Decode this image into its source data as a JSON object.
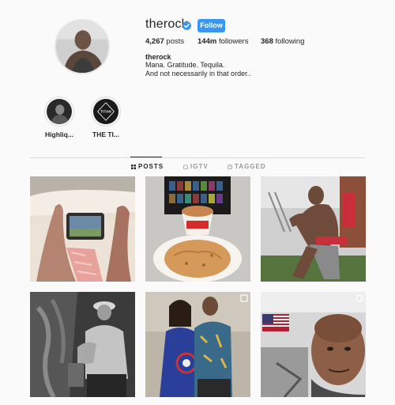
{
  "profile": {
    "username": "therock",
    "verified": true,
    "follow_label": "Follow",
    "posts_count": "4,267",
    "posts_label": "posts",
    "followers_count": "144m",
    "followers_label": "followers",
    "following_count": "368",
    "following_label": "following",
    "full_name": "therock",
    "bio_line1": "Mana. Gratitude. Tequila.",
    "bio_line2": "And not necessarily in that order.."
  },
  "highlights": [
    {
      "label": "Highliq...",
      "icon": "highlight-cover-photo"
    },
    {
      "label": "THE TI...",
      "icon": "titan-logo-icon",
      "logo_text": "TITAN"
    }
  ],
  "tabs": [
    {
      "label": "POSTS",
      "icon": "grid-icon",
      "active": true
    },
    {
      "label": "IGTV",
      "icon": "igtv-icon",
      "active": false
    },
    {
      "label": "TAGGED",
      "icon": "tag-icon",
      "active": false
    }
  ],
  "posts": [
    {
      "id": "post-1",
      "subject": "feet-tablet-bed"
    },
    {
      "id": "post-2",
      "subject": "cookie-and-tv"
    },
    {
      "id": "post-3",
      "subject": "gym-workout"
    },
    {
      "id": "post-4",
      "subject": "bw-worker"
    },
    {
      "id": "post-5",
      "subject": "graduation-photo",
      "multi": true
    },
    {
      "id": "post-6",
      "subject": "selfie-gym",
      "multi": true
    }
  ],
  "colors": {
    "accent": "#3897f0",
    "text": "#262626",
    "muted": "#999999",
    "background": "#fafafa",
    "border": "#dbdbdb"
  }
}
